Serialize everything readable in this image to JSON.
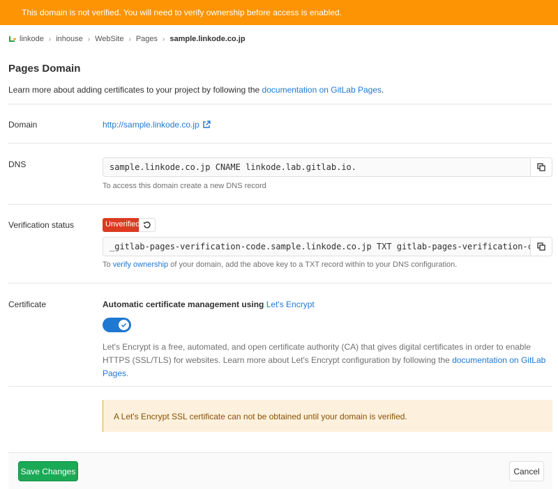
{
  "banner": {
    "text": "This domain is not verified. You will need to verify ownership before access is enabled."
  },
  "breadcrumb": {
    "items": [
      "linkode",
      "inhouse",
      "WebSite",
      "Pages"
    ],
    "current": "sample.linkode.co.jp"
  },
  "page": {
    "title": "Pages Domain",
    "intro_prefix": "Learn more about adding certificates to your project by following the ",
    "intro_link": "documentation on GitLab Pages",
    "intro_suffix": "."
  },
  "domain": {
    "label": "Domain",
    "url": "http://sample.linkode.co.jp"
  },
  "dns": {
    "label": "DNS",
    "record": "sample.linkode.co.jp CNAME linkode.lab.gitlab.io.",
    "help": "To access this domain create a new DNS record"
  },
  "verification": {
    "label": "Verification status",
    "badge": "Unverified",
    "record": "_gitlab-pages-verification-code.sample.linkode.co.jp TXT gitlab-pages-verification-code=",
    "help_prefix": "To ",
    "help_link": "verify ownership",
    "help_suffix": " of your domain, add the above key to a TXT record within to your DNS configuration."
  },
  "certificate": {
    "label": "Certificate",
    "title_prefix": "Automatic certificate management using ",
    "title_link": "Let's Encrypt",
    "toggle_on": true,
    "desc_prefix": "Let's Encrypt is a free, automated, and open certificate authority (CA) that gives digital certificates in order to enable HTTPS (SSL/TLS) for websites. Learn more about Let's Encrypt configuration by following the ",
    "desc_link": "documentation on GitLab Pages",
    "desc_suffix": ".",
    "alert": "A Let's Encrypt SSL certificate can not be obtained until your domain is verified."
  },
  "footer": {
    "save_label": "Save Changes",
    "cancel_label": "Cancel"
  },
  "colors": {
    "banner": "#fc9403",
    "link": "#1f78d1",
    "badge_danger": "#db3b21",
    "save_button": "#1aaa55",
    "alert_bg": "#fdf1dd"
  }
}
